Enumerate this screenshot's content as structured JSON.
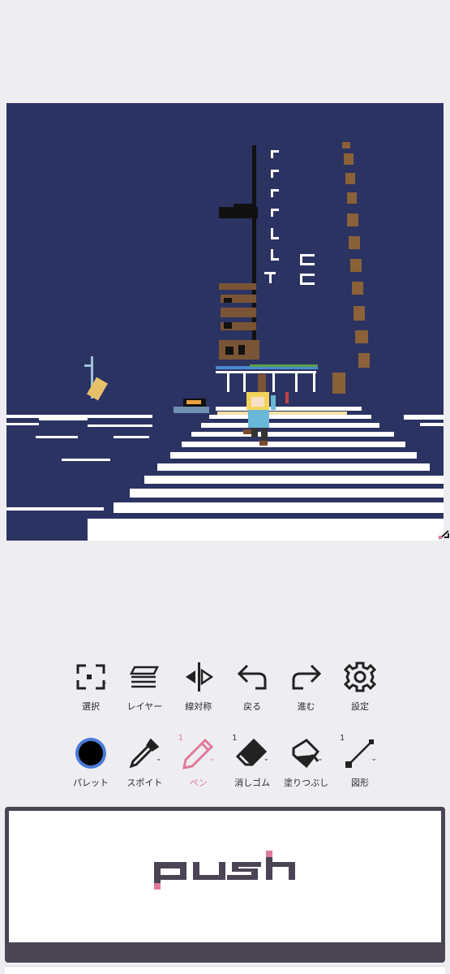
{
  "toolbar_row1": [
    {
      "name": "select",
      "label": "選択"
    },
    {
      "name": "layer",
      "label": "レイヤー"
    },
    {
      "name": "line-symmetry",
      "label": "線対称"
    },
    {
      "name": "undo",
      "label": "戻る"
    },
    {
      "name": "redo",
      "label": "進む"
    },
    {
      "name": "settings",
      "label": "設定"
    }
  ],
  "toolbar_row2": [
    {
      "name": "palette",
      "label": "パレット"
    },
    {
      "name": "eyedropper",
      "label": "スポイト"
    },
    {
      "name": "pen",
      "label": "ペン",
      "size": "1",
      "active": true
    },
    {
      "name": "eraser",
      "label": "消しゴム",
      "size": "1"
    },
    {
      "name": "fill",
      "label": "塗りつぶし"
    },
    {
      "name": "shape",
      "label": "図形",
      "size": "1"
    }
  ],
  "push_button": {
    "label": "push"
  },
  "colors": {
    "background": "#eeedf2",
    "canvas_night": "#2b3362",
    "accent_pink": "#e07a9a",
    "current_color": "#000000",
    "push_frame": "#4a4455"
  },
  "icons": [
    "select-icon",
    "layer-icon",
    "symmetry-icon",
    "undo-icon",
    "redo-icon",
    "gear-icon",
    "palette-icon",
    "eyedropper-icon",
    "pen-icon",
    "eraser-icon",
    "fill-bucket-icon",
    "line-shape-icon"
  ]
}
